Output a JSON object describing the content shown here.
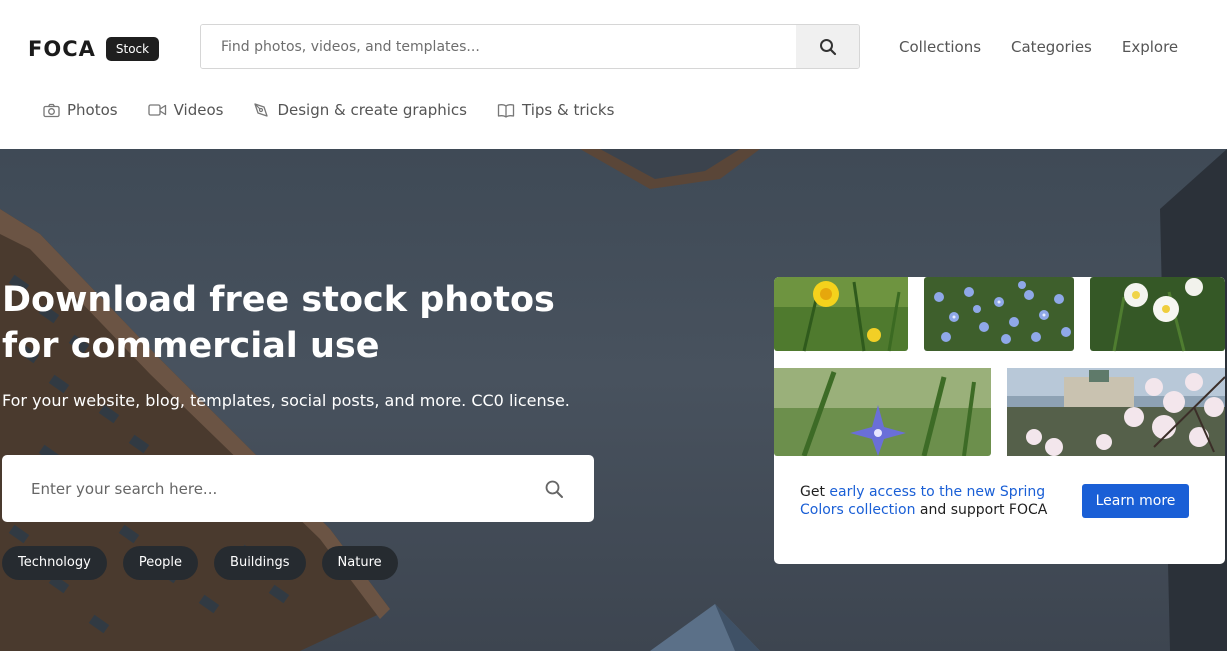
{
  "brand": {
    "name": "FOCA",
    "badge": "Stock"
  },
  "top_search": {
    "placeholder": "Find photos, videos, and templates..."
  },
  "top_nav": [
    {
      "label": "Collections"
    },
    {
      "label": "Categories"
    },
    {
      "label": "Explore"
    }
  ],
  "sub_nav": [
    {
      "label": "Photos",
      "icon": "camera-icon"
    },
    {
      "label": "Videos",
      "icon": "video-icon"
    },
    {
      "label": "Design & create graphics",
      "icon": "pen-tool-icon"
    },
    {
      "label": "Tips & tricks",
      "icon": "book-icon"
    }
  ],
  "hero": {
    "title": "Download free stock photos for commercial use",
    "subtitle": "For your website, blog, templates, social posts, and more. CC0 license.",
    "search_placeholder": "Enter your search here...",
    "tags": [
      "Technology",
      "People",
      "Buildings",
      "Nature"
    ]
  },
  "promo": {
    "text_before": "Get ",
    "link_text": "early access to the new Spring Colors collection",
    "text_after": " and support FOCA",
    "button_label": "Learn more",
    "link_color": "#1a5fd6",
    "button_color": "#1a5fd6"
  }
}
